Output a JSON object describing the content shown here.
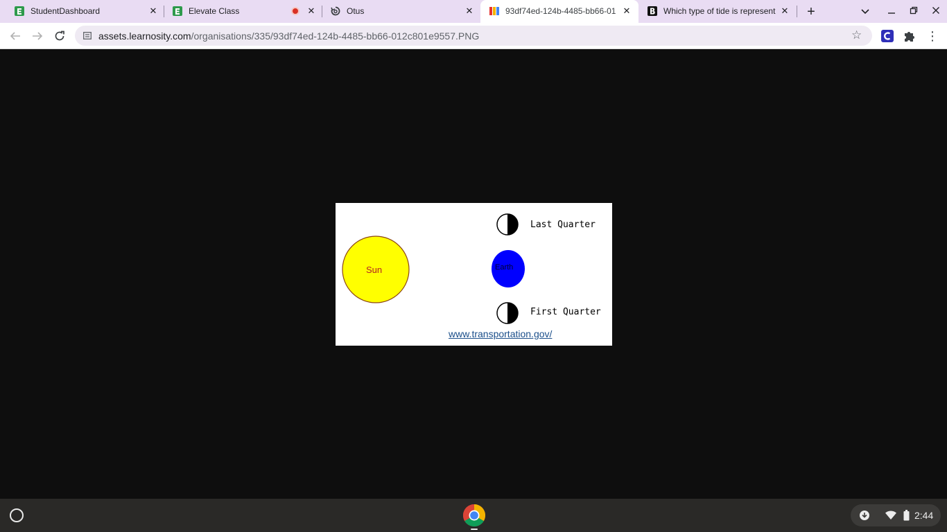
{
  "browser": {
    "tabs": [
      {
        "title": "StudentDashboard",
        "favicon": "e-green-icon",
        "active": false
      },
      {
        "title": "Elevate Class",
        "favicon": "e-green-icon",
        "active": false,
        "recording": true
      },
      {
        "title": "Otus",
        "favicon": "otus-swirl-icon",
        "active": false
      },
      {
        "title": "93df74ed-124b-4485-bb66-01",
        "favicon": "books-icon",
        "active": true
      },
      {
        "title": "Which type of tide is represent",
        "favicon": "b-bold-icon",
        "active": false
      }
    ],
    "url": {
      "host": "assets.learnosity.com",
      "path": "/organisations/335/93df74ed-124b-4485-bb66-012c801e9557.PNG"
    },
    "extensions": [
      "c-extension-icon",
      "puzzle-icon"
    ]
  },
  "diagram": {
    "sun_label": "Sun",
    "earth_label": "Earth",
    "top_moon_label": "Last Quarter",
    "bottom_moon_label": "First Quarter",
    "source_link": "www.transportation.gov/",
    "colors": {
      "sun": "#ffff00",
      "sun_outline": "#8b4513",
      "sun_text": "#b22222",
      "earth": "#0000ff"
    }
  },
  "shelf": {
    "clock": "2:44"
  }
}
